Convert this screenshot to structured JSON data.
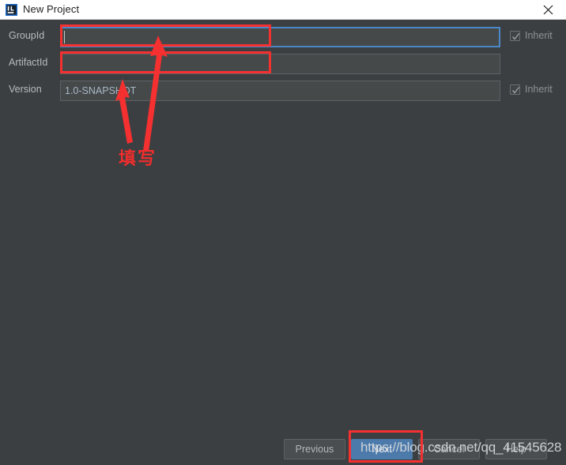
{
  "window": {
    "title": "New Project",
    "app_icon": "intellij-idea-logo",
    "close_icon": "close-icon"
  },
  "form": {
    "fields": [
      {
        "label": "GroupId",
        "value": "",
        "placeholder": "",
        "focused": true,
        "has_inherit": true,
        "inherit_label": "Inherit",
        "inherit_checked": true
      },
      {
        "label": "ArtifactId",
        "value": "",
        "placeholder": "",
        "focused": false,
        "has_inherit": false,
        "inherit_label": "",
        "inherit_checked": false
      },
      {
        "label": "Version",
        "value": "1.0-SNAPSHOT",
        "placeholder": "",
        "focused": false,
        "has_inherit": true,
        "inherit_label": "Inherit",
        "inherit_checked": true
      }
    ]
  },
  "buttons": {
    "previous": "Previous",
    "next": "Next",
    "cancel": "Cancel",
    "help": "Help"
  },
  "annotations": {
    "note_cn": "填写",
    "arrow_count": 2,
    "highlight_color": "#f53030"
  },
  "watermark": {
    "text": "https://blog.csdn.net/qq_41545628"
  },
  "colors": {
    "dialog_background": "#3c3f41",
    "field_background": "#45494a",
    "field_border": "#5e6264",
    "focus_border": "#4a88c7",
    "primary_button": "#4c7aab",
    "title_bar": "#ffffff",
    "label_text": "#b9bcbd"
  }
}
